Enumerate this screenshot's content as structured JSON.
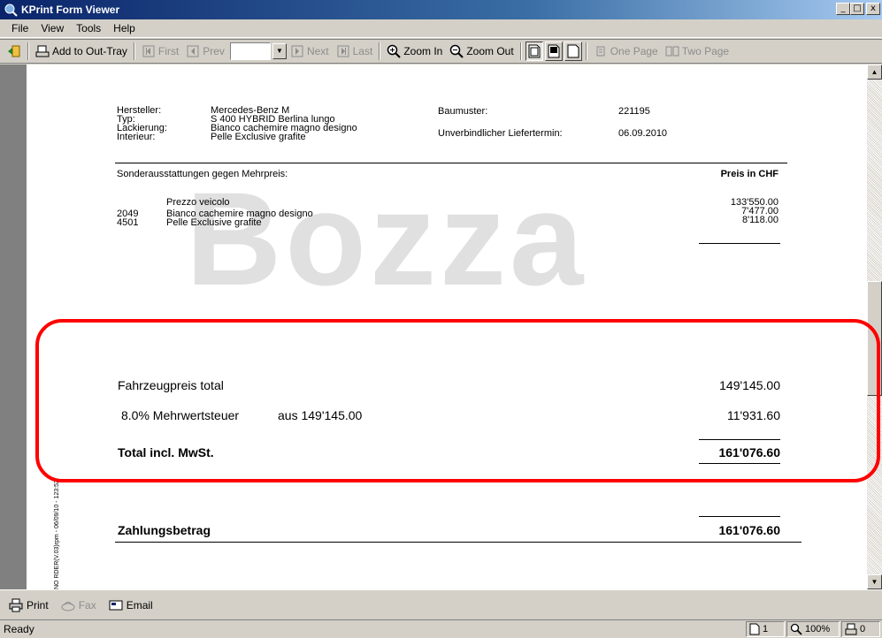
{
  "window": {
    "title": "KPrint Form Viewer",
    "buttons": [
      "_",
      "□",
      "x"
    ]
  },
  "menu": [
    "File",
    "View",
    "Tools",
    "Help"
  ],
  "toolbar": {
    "add_to_out_tray": "Add to Out-Tray",
    "first": "First",
    "prev": "Prev",
    "next": "Next",
    "last": "Last",
    "zoom_in": "Zoom In",
    "zoom_out": "Zoom Out",
    "one_page": "One Page",
    "two_page": "Two Page"
  },
  "doc": {
    "watermark": "Bozza",
    "labels": {
      "hersteller": "Hersteller:",
      "typ": "Typ:",
      "lackierung": "Lackierung:",
      "interieur": "Interieur:",
      "baumuster": "Baumuster:",
      "liefertermin": "Unverbindlicher Liefertermin:"
    },
    "values": {
      "hersteller": "Mercedes-Benz   M",
      "typ": "S 400 HYBRID Berlina lungo",
      "lackierung": "Bianco cachemire magno designo",
      "interieur": "Pelle Exclusive grafite",
      "baumuster": "221195",
      "liefertermin": "06.09.2010"
    },
    "sonder_header": "Sonderausstattungen gegen Mehrpreis:",
    "preis_header": "Preis in CHF",
    "items": [
      {
        "code": "",
        "desc": "Prezzo veicolo",
        "price": "133'550.00"
      },
      {
        "code": "2049",
        "desc": "Bianco cachemire magno designo",
        "price": "7'477.00"
      },
      {
        "code": "4501",
        "desc": "Pelle Exclusive grafite",
        "price": "8'118.00"
      }
    ],
    "fahrzeugpreis_label": "Fahrzeugpreis total",
    "fahrzeugpreis_value": "149'145.00",
    "mwst_label": "8.0% Mehrwertsteuer",
    "mwst_basis": "aus  149'145.00",
    "mwst_value": "11'931.60",
    "total_label": "Total incl. MwSt.",
    "total_value": "161'076.60",
    "zahlung_label": "Zahlungsbetrag",
    "zahlung_value": "161'076.60",
    "side_text": "NO RDER(V.03)rpm - 06/09/10 - 123:52"
  },
  "bottom": {
    "print": "Print",
    "fax": "Fax",
    "email": "Email"
  },
  "status": {
    "ready": "Ready",
    "page": "1",
    "zoom": "100%",
    "tray": "0"
  },
  "colors": {
    "titlebar": "#0a246a",
    "highlight": "#ff0000",
    "watermark": "#e0e0e0"
  }
}
